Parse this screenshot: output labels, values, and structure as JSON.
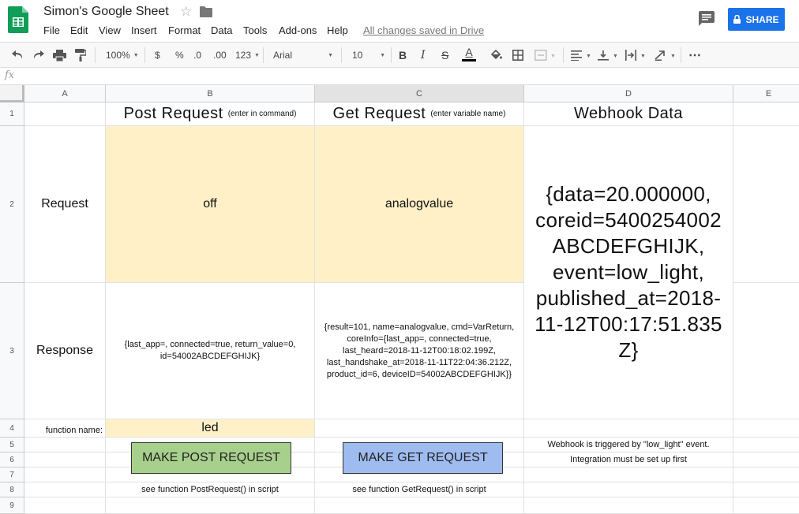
{
  "header": {
    "doc_title": "Simon's Google Sheet",
    "menu": [
      "File",
      "Edit",
      "View",
      "Insert",
      "Format",
      "Data",
      "Tools",
      "Add-ons",
      "Help"
    ],
    "save_status": "All changes saved in Drive",
    "share_label": "SHARE"
  },
  "toolbar": {
    "zoom": "100%",
    "currency": "$",
    "percent": "%",
    "decrease_decimals": ".0",
    "increase_decimals": ".00",
    "more_formats": "123",
    "font": "Arial",
    "font_size": "10",
    "bold": "B",
    "italic": "I",
    "strikethrough": "S",
    "text_color": "A",
    "more": "⋯"
  },
  "formula_bar": {
    "fx": "fx",
    "value": ""
  },
  "grid": {
    "columns": [
      "A",
      "B",
      "C",
      "D",
      "E"
    ],
    "rows": [
      "1",
      "2",
      "3",
      "4",
      "5",
      "6",
      "7",
      "8",
      "9"
    ],
    "cells": {
      "B1_title": "Post Request",
      "B1_note": "(enter in command)",
      "C1_title": "Get Request",
      "C1_note": "(enter variable name)",
      "D1": "Webhook Data",
      "A2": "Request",
      "B2": "off",
      "C2": "analogvalue",
      "D2": "{data=20.000000, coreid=5400254002 ABCDEFGHIJK, event=low_light, published_at=2018-11-12T00:17:51.835 Z}",
      "A3": "Response",
      "B3": "{last_app=, connected=true, return_value=0, id=54002ABCDEFGHIJK}",
      "C3": "{result=101, name=analogvalue, cmd=VarReturn, coreInfo={last_app=, connected=true, last_heard=2018-11-12T00:18:02.199Z, last_handshake_at=2018-11-11T22:04:36.212Z, product_id=6, deviceID=54002ABCDEFGHIJK}}",
      "A4": "function name:",
      "B4": "led",
      "D5": "Webhook is triggered by \"low_light\" event.",
      "D6": "Integration must be set up first",
      "B8": "see function PostRequest() in script",
      "C8": "see function GetRequest() in script"
    },
    "buttons": {
      "post": "MAKE POST REQUEST",
      "get": "MAKE GET REQUEST"
    }
  },
  "colors": {
    "share": "#1a73e8",
    "yellow_cell": "#fff0c8",
    "post_button": "#a8d08d",
    "get_button": "#9fbcf0",
    "sheets_green": "#0f9d58"
  }
}
